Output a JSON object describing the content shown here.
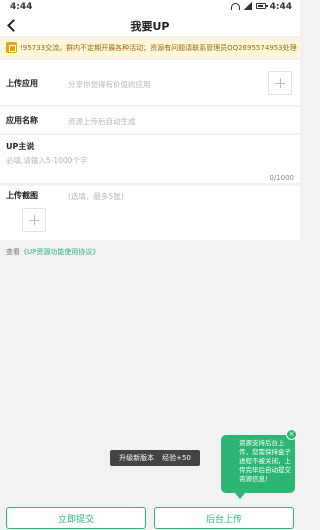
{
  "status_bar": {
    "time": "4:44",
    "time_right": "4:44",
    "menu": "···"
  },
  "header": {
    "title": "我要UP"
  },
  "notice": {
    "text": "!95733交流。群内不定期开展各种活动；资源有问题请联系管理员QQ2695574953处理~"
  },
  "form": {
    "upload_app": {
      "label": "上传应用",
      "placeholder": "分享你觉得有价值的应用"
    },
    "app_name": {
      "label": "应用名称",
      "placeholder": "资源上传后自动生成"
    },
    "up_desc": {
      "label": "UP主说",
      "placeholder": "必填,请输入5-1000个字",
      "counter": "0/1000"
    },
    "screenshots": {
      "label": "上传截图",
      "hint": "(选填，最多5张)"
    }
  },
  "agreement": {
    "prefix": "查看",
    "link": "《UP资源功能使用协议》"
  },
  "toast": {
    "text": "升级新版本",
    "exp": "经验+50"
  },
  "bubble": {
    "text": "资源支持后台上传，您需保持盒子进程不被关闭，上传完毕后自动提交资源信息！",
    "close": "×"
  },
  "buttons": {
    "submit": "立即提交",
    "background": "后台上传"
  },
  "colors": {
    "accent": "#2bb673",
    "notice_bg": "#fff7dc",
    "notice_text": "#9a6a00"
  }
}
